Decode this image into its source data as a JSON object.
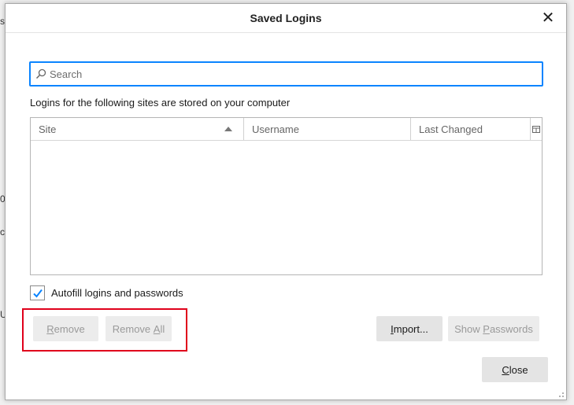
{
  "window": {
    "title": "Saved Logins",
    "close_label": "✕"
  },
  "search": {
    "placeholder": "Search",
    "value": ""
  },
  "info_text": "Logins for the following sites are stored on your computer",
  "table": {
    "columns": [
      {
        "label": "Site",
        "sorted": "ascending"
      },
      {
        "label": "Username"
      },
      {
        "label": "Last Changed"
      }
    ],
    "rows": []
  },
  "autofill": {
    "label": "Autofill logins and passwords",
    "checked": true
  },
  "buttons": {
    "remove": {
      "pre": "",
      "key": "R",
      "post": "emove",
      "enabled": false
    },
    "remove_all": {
      "pre": "Remove ",
      "key": "A",
      "post": "ll",
      "enabled": false
    },
    "import": {
      "pre": "",
      "key": "I",
      "post": "mport...",
      "enabled": true
    },
    "show_passwords": {
      "pre": "Show ",
      "key": "P",
      "post": "asswords",
      "enabled": false
    },
    "close": {
      "pre": "",
      "key": "C",
      "post": "lose",
      "enabled": true
    }
  },
  "background_fragments": [
    "s",
    "0",
    "c",
    "U"
  ],
  "colors": {
    "focus_accent": "#0a84ff",
    "checkmark": "#0a84ff",
    "annotation_box": "#e0001b"
  }
}
